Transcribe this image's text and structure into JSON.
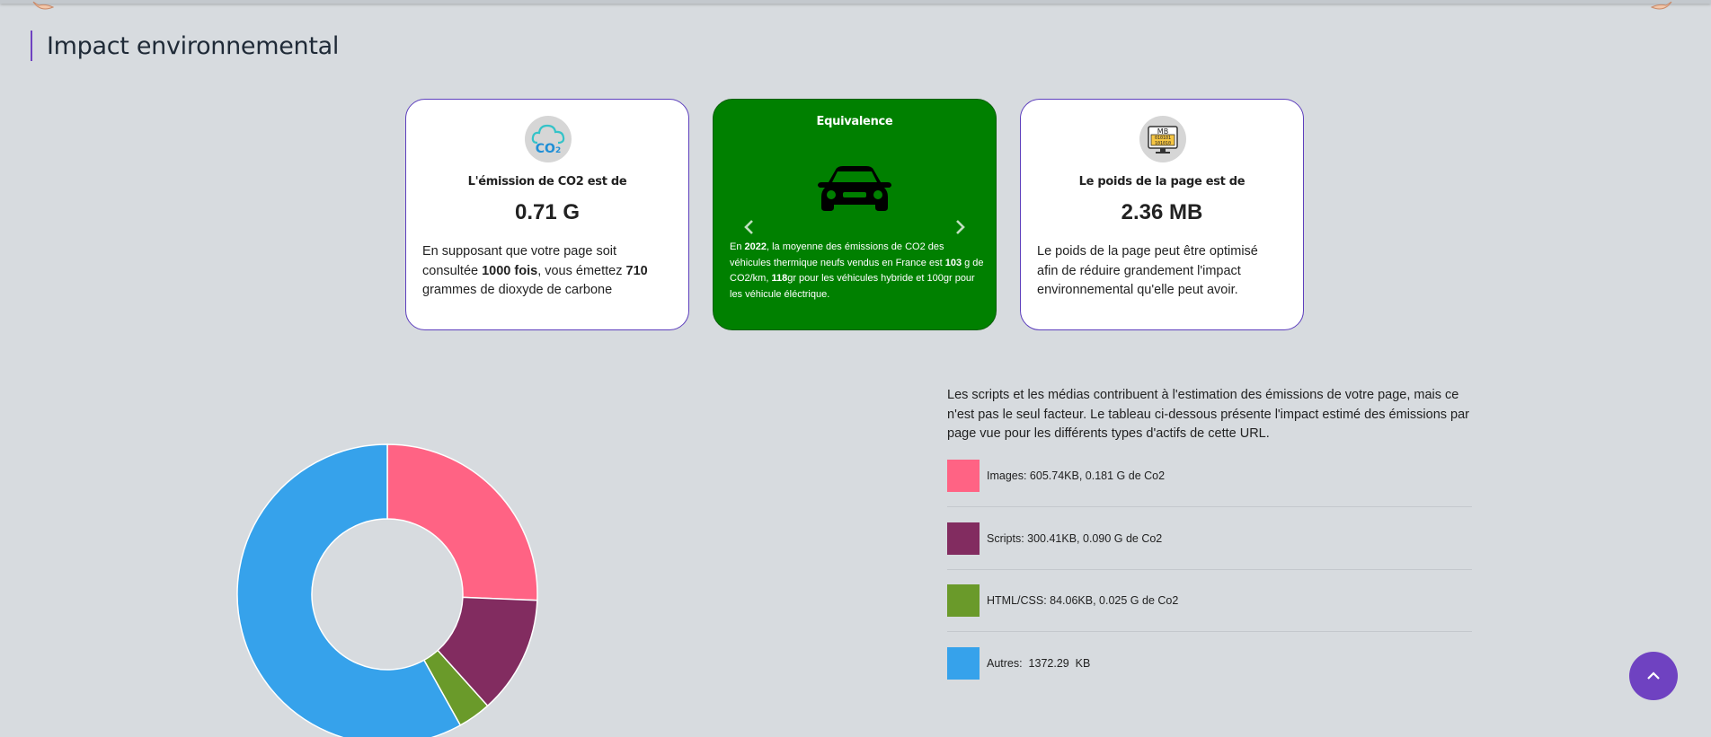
{
  "section": {
    "title": "Impact environnemental"
  },
  "co2_card": {
    "icon": "co2-cloud-icon",
    "label": "L'émission de CO2 est de",
    "value": "0.71 G",
    "text_pre": "En supposant que votre page soit consultée ",
    "text_visits": "1000 fois",
    "text_mid": ", vous émettez ",
    "text_grams": "710",
    "text_post": " grammes de dioxyde de carbone"
  },
  "equivalence_card": {
    "title": "Equivalence",
    "icon": "car-icon",
    "text_1": "En ",
    "year": "2022",
    "text_2": ", la moyenne des émissions de CO2 des véhicules thermique neufs vendus en France est ",
    "thermal": "103",
    "text_3": " g de CO2/km, ",
    "hybrid": "118",
    "text_4": "gr pour les véhicules hybride et 100gr pour les véhicule éléctrique.",
    "bg_color": "#008000"
  },
  "weight_card": {
    "icon": "mb-monitor-icon",
    "label": "Le poids de la page est de",
    "value": "2.36 MB",
    "text": "Le poids de la page peut être optimisé afin de réduire grandement l'impact environnemental qu'elle peut avoir."
  },
  "legend": {
    "intro": "Les scripts et les médias contribuent à l'estimation des émissions de votre page, mais ce n'est pas le seul facteur. Le tableau ci-dessous présente l'impact estimé des émissions par page vue pour les différents types d'actifs de cette URL.",
    "items": [
      {
        "label": "Images: 605.74KB, 0.181 G de Co2",
        "color": "#ff6384"
      },
      {
        "label": "Scripts: 300.41KB, 0.090 G de Co2",
        "color": "#822c60"
      },
      {
        "label": "HTML/CSS: 84.06KB, 0.025 G de Co2",
        "color": "#6a9a2a"
      },
      {
        "label": "Autres:  1372.29  KB",
        "color": "#36a2eb"
      }
    ]
  },
  "chart_data": {
    "type": "pie",
    "categories": [
      "Images",
      "Scripts",
      "HTML/CSS",
      "Autres"
    ],
    "values": [
      605.74,
      300.41,
      84.06,
      1372.29
    ],
    "colors": [
      "#ff6384",
      "#822c60",
      "#6a9a2a",
      "#36a2eb"
    ],
    "donut": true
  },
  "accent_color": "#6f42c1"
}
